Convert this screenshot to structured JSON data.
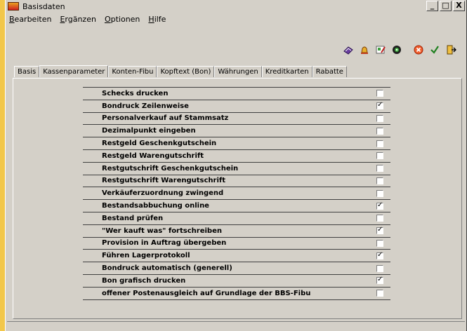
{
  "window": {
    "title": "Basisdaten"
  },
  "titlebar_buttons": {
    "minimize": "_",
    "maximize": "□",
    "close": "X"
  },
  "menu": [
    {
      "label": "Bearbeiten",
      "accel": "B",
      "rest": "earbeiten"
    },
    {
      "label": "Ergänzen",
      "accel": "E",
      "rest": "rgänzen"
    },
    {
      "label": "Optionen",
      "accel": "O",
      "rest": "ptionen"
    },
    {
      "label": "Hilfe",
      "accel": "H",
      "rest": "ilfe"
    }
  ],
  "toolbar_icons": [
    "book-icon",
    "bell-icon",
    "image-edit-icon",
    "record-icon",
    "cancel-icon",
    "checkmark-icon",
    "exit-door-icon"
  ],
  "tabs": [
    {
      "label": "Basis",
      "active": false
    },
    {
      "label": "Kassenparameter",
      "active": true
    },
    {
      "label": "Konten-Fibu",
      "active": false
    },
    {
      "label": "Kopftext (Bon)",
      "active": false
    },
    {
      "label": "Währungen",
      "active": false
    },
    {
      "label": "Kreditkarten",
      "active": false
    },
    {
      "label": "Rabatte",
      "active": false
    }
  ],
  "settings": [
    {
      "label": "Schecks drucken",
      "checked": false
    },
    {
      "label": "Bondruck Zeilenweise",
      "checked": true
    },
    {
      "label": "Personalverkauf auf Stammsatz",
      "checked": false
    },
    {
      "label": "Dezimalpunkt eingeben",
      "checked": false
    },
    {
      "label": "Restgeld Geschenkgutschein",
      "checked": false
    },
    {
      "label": "Restgeld Warengutschrift",
      "checked": false
    },
    {
      "label": "Restgutschrift Geschenkgutschein",
      "checked": false
    },
    {
      "label": "Restgutschrift Warengutschrift",
      "checked": false
    },
    {
      "label": "Verkäuferzuordnung zwingend",
      "checked": false
    },
    {
      "label": "Bestandsabbuchung online",
      "checked": true
    },
    {
      "label": "Bestand prüfen",
      "checked": false
    },
    {
      "label": "\"Wer kauft was\" fortschreiben",
      "checked": true
    },
    {
      "label": "Provision in Auftrag übergeben",
      "checked": false
    },
    {
      "label": "Führen Lagerprotokoll",
      "checked": true
    },
    {
      "label": "Bondruck automatisch (generell)",
      "checked": false
    },
    {
      "label": "Bon grafisch drucken",
      "checked": true
    },
    {
      "label": "offener Postenausgleich auf Grundlage der BBS-Fibu",
      "checked": false
    }
  ]
}
